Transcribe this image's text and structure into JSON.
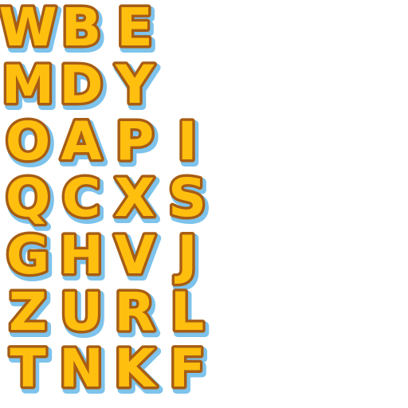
{
  "letter_sheet": {
    "rows": [
      [
        "W",
        "B",
        "E"
      ],
      [
        "M",
        "D",
        "Y"
      ],
      [
        "O",
        "A",
        "P",
        "I"
      ],
      [
        "Q",
        "C",
        "X",
        "S"
      ],
      [
        "G",
        "H",
        "V",
        "J"
      ],
      [
        "Z",
        "U",
        "R",
        "L"
      ],
      [
        "T",
        "N",
        "K",
        "F"
      ]
    ]
  },
  "colors": {
    "face": "#ffbf0f",
    "outline": "#a75d14",
    "shadow": "#7dc3ec",
    "background": "#ffffff"
  }
}
